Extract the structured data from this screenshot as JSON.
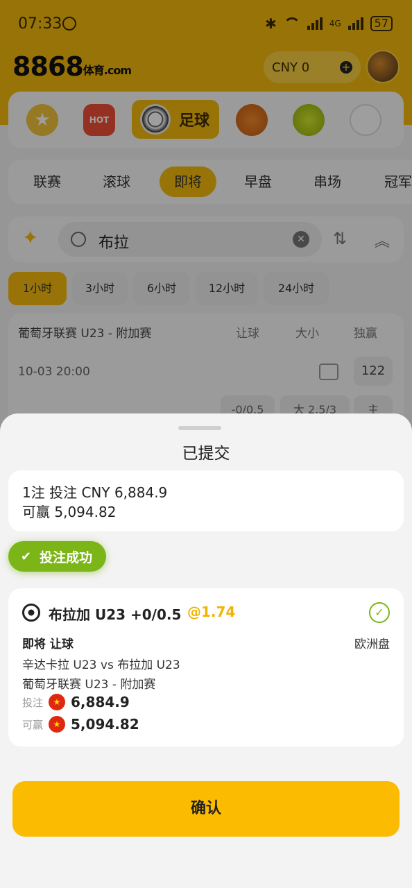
{
  "status_bar": {
    "time": "07:33",
    "network": "4G",
    "battery": "57"
  },
  "header": {
    "logo": "8868",
    "logo_sub": "体育.com",
    "currency": "CNY",
    "balance": "0"
  },
  "sports": {
    "selected_label": "足球",
    "hot_label": "HOT"
  },
  "tabs": [
    "联赛",
    "滚球",
    "即将",
    "早盘",
    "串场",
    "冠军"
  ],
  "search": {
    "query": "布拉"
  },
  "time_filters": [
    "1小时",
    "3小时",
    "6小时",
    "12小时",
    "24小时"
  ],
  "match": {
    "league": "葡萄牙联赛 U23 - 附加赛",
    "columns": [
      "让球",
      "大小",
      "独赢"
    ],
    "datetime": "10-03 20:00",
    "market_count": "122",
    "odds_preview": [
      "-0/0.5",
      "大 2.5/3",
      "主"
    ]
  },
  "sheet": {
    "title": "已提交",
    "summary_line1": "1注 投注 CNY 6,884.9",
    "summary_line2": "可赢 5,094.82",
    "success_label": "投注成功",
    "bet": {
      "selection": "布拉加 U23 +0/0.5",
      "odds": "@1.74",
      "type": "即将 让球",
      "market": "欧洲盘",
      "teams": "辛达卡拉 U23 vs 布拉加 U23",
      "league": "葡萄牙联赛 U23 - 附加赛",
      "stake_label": "投注",
      "stake": "6,884.9",
      "win_label": "可赢",
      "win": "5,094.82"
    },
    "confirm_label": "确认"
  }
}
